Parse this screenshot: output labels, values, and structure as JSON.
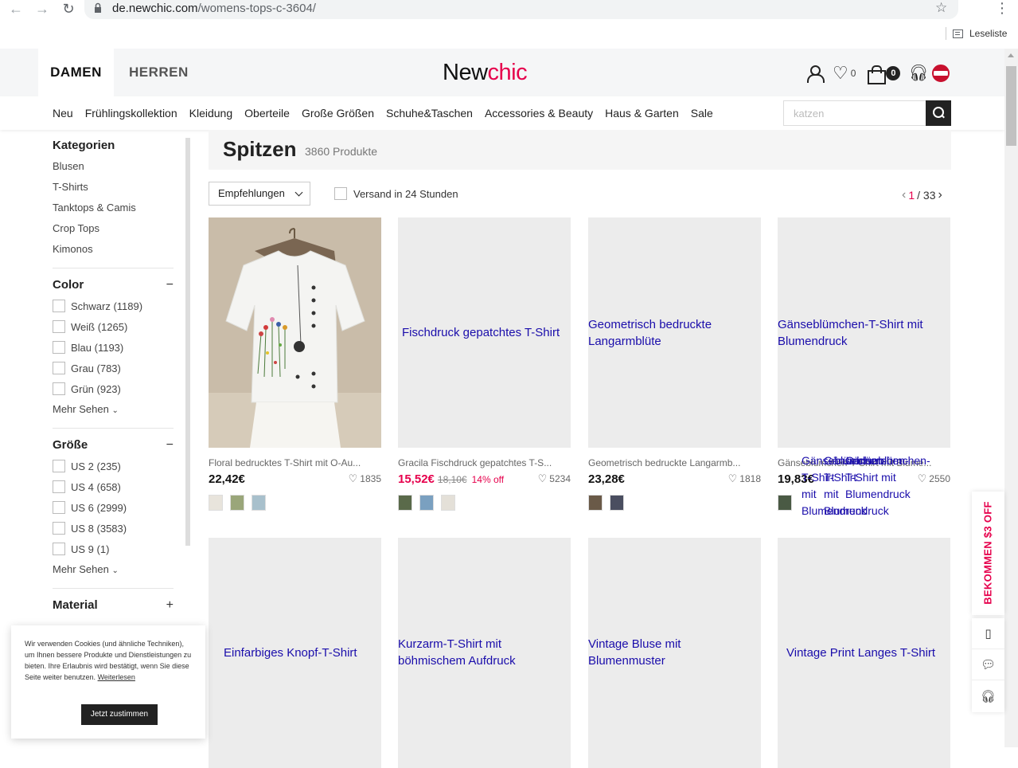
{
  "browser": {
    "url_host": "de.newchic.com",
    "url_path": "/womens-tops-c-3604/",
    "reading_list": "Leseliste"
  },
  "header": {
    "tab_women": "DAMEN",
    "tab_men": "HERREN",
    "logo_part1": "New",
    "logo_part2": "chic",
    "wishlist_count": "0",
    "cart_count": "0"
  },
  "nav": {
    "items": [
      "Neu",
      "Frühlingskollektion",
      "Kleidung",
      "Oberteile",
      "Große Größen",
      "Schuhe&Taschen",
      "Accessories & Beauty",
      "Haus & Garten",
      "Sale"
    ],
    "search_placeholder": "katzen"
  },
  "sidebar": {
    "categories_title": "Kategorien",
    "categories": [
      "Blusen",
      "T-Shirts",
      "Tanktops & Camis",
      "Crop Tops",
      "Kimonos"
    ],
    "color_title": "Color",
    "colors": [
      "Schwarz (1189)",
      "Weiß (1265)",
      "Blau (1193)",
      "Grau (783)",
      "Grün (923)"
    ],
    "more_label": "Mehr Sehen",
    "size_title": "Größe",
    "sizes": [
      "US 2 (235)",
      "US 4 (658)",
      "US 6 (2999)",
      "US 8 (3583)",
      "US 9 (1)"
    ],
    "material_title": "Material"
  },
  "listing": {
    "title": "Spitzen",
    "count": "3860 Produkte",
    "sort_label": "Empfehlungen",
    "ship_filter": "Versand in 24 Stunden",
    "page_current": "1",
    "page_total": "/ 33"
  },
  "products": [
    {
      "name": "Floral bedrucktes T-Shirt mit O-Au...",
      "price": "22,42€",
      "likes": "1835",
      "alt": ""
    },
    {
      "name": "Gracila Fischdruck gepatchtes T-S...",
      "price": "15,52€",
      "old": "18,10€",
      "disc": "14% off",
      "likes": "5234",
      "alt": "Fischdruck gepatchtes T-Shirt"
    },
    {
      "name": "Geometrisch bedruckte Langarmb...",
      "price": "23,28€",
      "likes": "1818",
      "alt": "Geometrisch bedruckte Langarmblüte"
    },
    {
      "name": "Gänseblümchen-T-Shirt mit Blume...",
      "price": "19,83€",
      "likes": "2550",
      "alt": "Gänseblümchen-T-Shirt mit Blumendruck"
    },
    {
      "alt": "Einfarbiges Knopf-T-Shirt"
    },
    {
      "alt": "Kurzarm-T-Shirt mit böhmischem Aufdruck"
    },
    {
      "alt": "Vintage Bluse mit Blumenmuster"
    },
    {
      "alt": "Vintage Print Langes T-Shirt"
    }
  ],
  "overlay_text": {
    "broken_alt_a": "Gänseblümchen-",
    "broken_alt_b": "T-Shirt mit Blumendruck"
  },
  "cookie": {
    "text": "Wir verwenden Cookies (und ähnliche Techniken), um Ihnen bessere Produkte und Dienstleistungen zu bieten. Ihre Erlaubnis wird bestätigt, wenn Sie diese Seite weiter benutzen.",
    "link": "Weiterlesen",
    "button": "Jetzt zustimmen"
  },
  "coupon": "BEKOMMEN $3 OFF",
  "colors": {
    "accent": "#e6004c",
    "link": "#1a0dab"
  }
}
